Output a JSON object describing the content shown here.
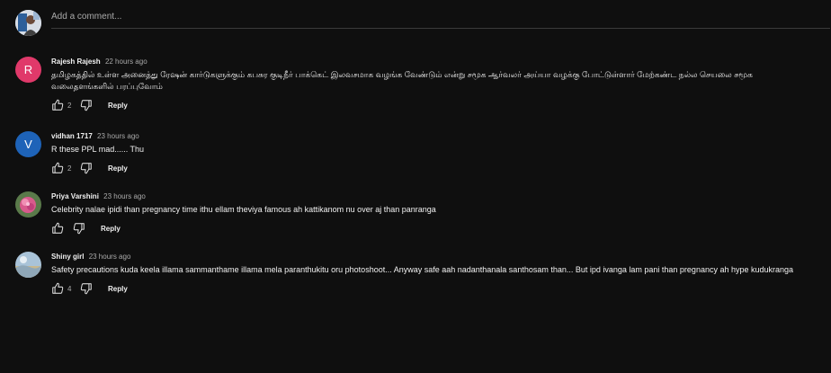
{
  "add_comment": {
    "placeholder": "Add a comment..."
  },
  "labels": {
    "reply": "Reply"
  },
  "colors": {
    "background": "#0f0f0f",
    "avatar_r": "#e0396a",
    "avatar_v": "#1e63b8"
  },
  "comments": [
    {
      "author": "Rajesh Rajesh",
      "time": "22 hours ago",
      "avatar_letter": "R",
      "text": "தமிழகத்தில் உள்ள அனைத்து ரேஷன் கார்டுகளுக்கும் கபசுர குடிநீர் பாக்கெட் இலவசமாக வழங்க வேண்டும் என்று சமூக ஆர்வலர் அய்யா வழக்கு போட்டுள்ளார் மேற்கண்ட நல்ல செயலை சமூக வலைதளங்களில் பரப்புவோம்",
      "likes": "2"
    },
    {
      "author": "vidhan 1717",
      "time": "23 hours ago",
      "avatar_letter": "V",
      "text": "R these PPL mad...... Thu",
      "likes": "2"
    },
    {
      "author": "Priya Varshini",
      "time": "23 hours ago",
      "avatar_letter": "",
      "text": "Celebrity nalae ipidi than pregnancy time ithu ellam theviya famous ah kattikanom nu over aj than panranga",
      "likes": ""
    },
    {
      "author": "Shiny girl",
      "time": "23 hours ago",
      "avatar_letter": "",
      "text": "Safety precautions kuda keela illama sammanthame illama mela paranthukitu oru photoshoot... Anyway safe aah nadanthanala santhosam than... But ipd ivanga lam pani than pregnancy ah hype kudukranga",
      "likes": "4"
    }
  ]
}
